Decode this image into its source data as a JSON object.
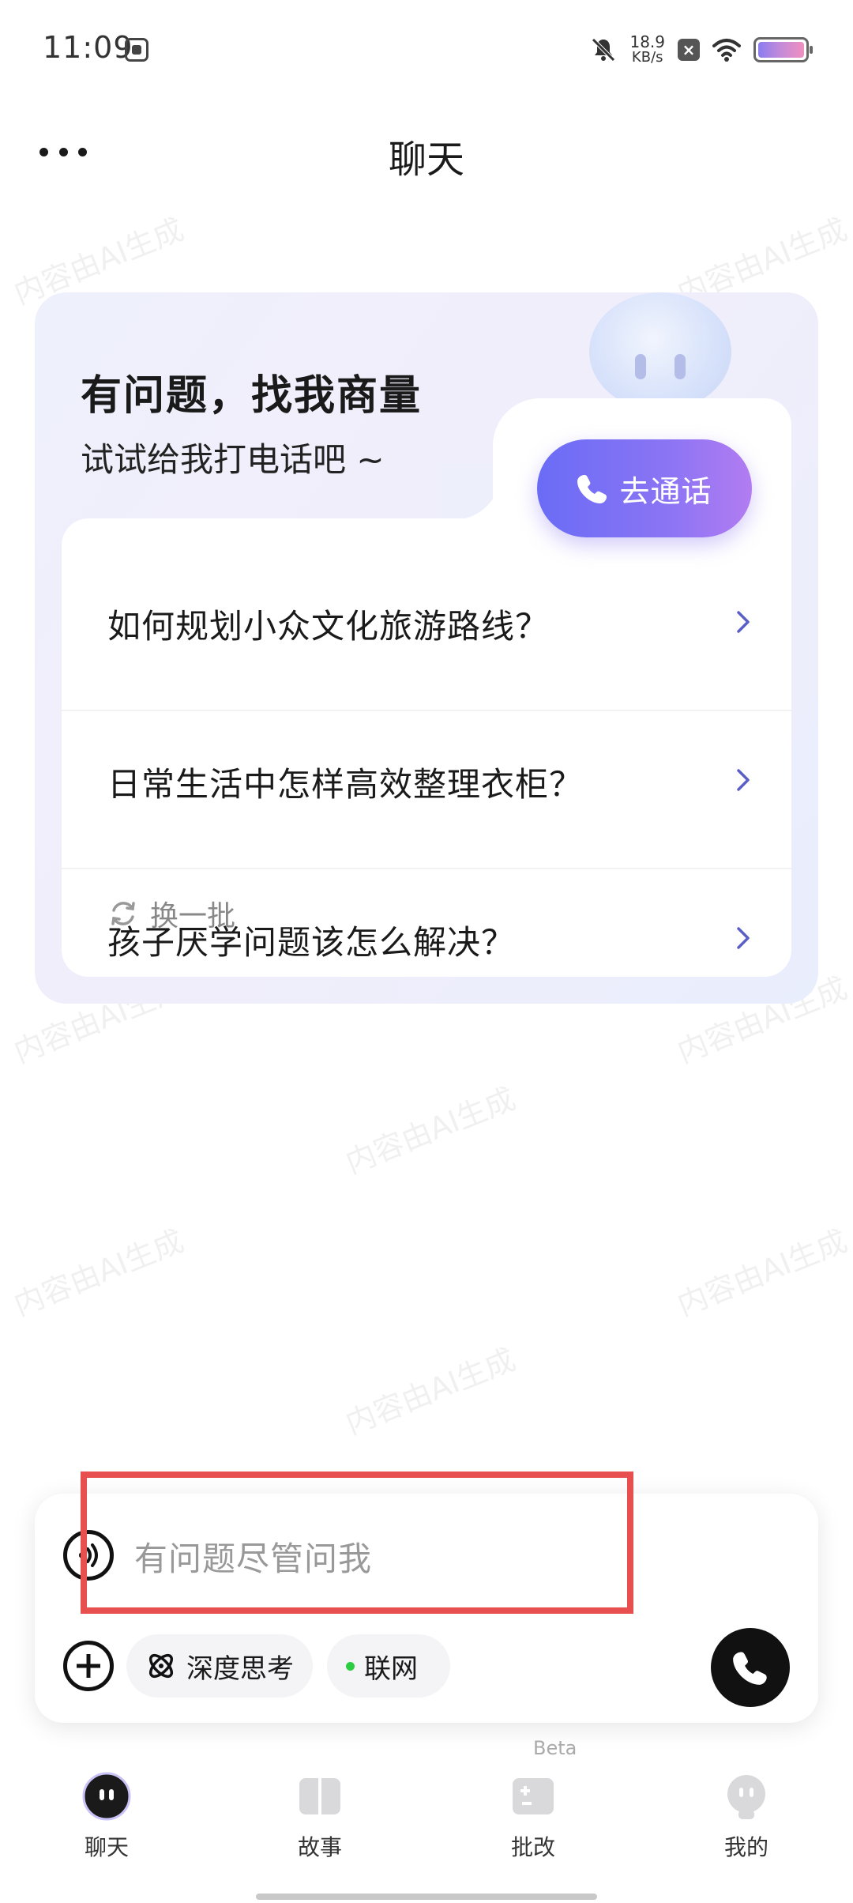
{
  "status_bar": {
    "time": "11:09",
    "net_speed_value": "18.9",
    "net_speed_unit": "KB/s",
    "icons": [
      "app-notification-icon",
      "mute-icon",
      "close-box-icon",
      "wifi-icon",
      "battery-icon"
    ]
  },
  "header": {
    "title": "聊天",
    "more_icon": "more-dots-icon"
  },
  "watermark": "内容由AI生成",
  "card": {
    "title": "有问题，找我商量",
    "subtitle": "试试给我打电话吧 ~",
    "call_button_label": "去通话",
    "questions": [
      "如何规划小众文化旅游路线？",
      "日常生活中怎样高效整理衣柜？",
      "孩子厌学问题该怎么解决？"
    ],
    "refresh_label": "换一批"
  },
  "input": {
    "placeholder": "有问题尽管问我",
    "chips": {
      "deep_think": "深度思考",
      "web": "联网"
    }
  },
  "bottom_nav": {
    "items": [
      {
        "label": "聊天",
        "icon": "chat-bot-icon"
      },
      {
        "label": "故事",
        "icon": "book-icon"
      },
      {
        "label": "批改",
        "icon": "grading-icon"
      },
      {
        "label": "我的",
        "icon": "profile-icon"
      }
    ],
    "beta_label": "Beta"
  },
  "colors": {
    "accent_start": "#6a6cf6",
    "accent_end": "#b27cf2",
    "highlight_border": "#e85050",
    "online_dot": "#2ecc40"
  }
}
